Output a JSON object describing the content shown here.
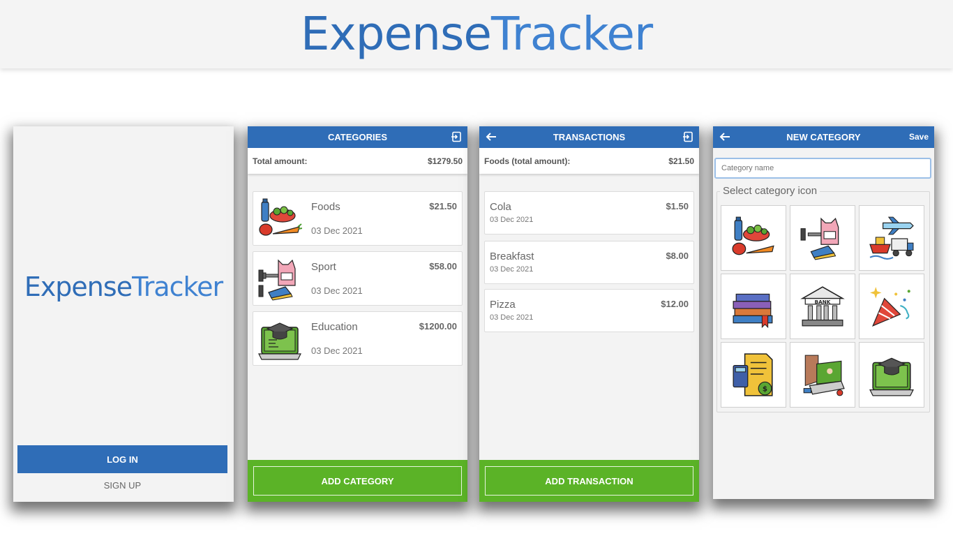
{
  "banner": {
    "logo_part1": "Expense",
    "logo_part2": "Tracker"
  },
  "login_screen": {
    "logo_part1": "Expense",
    "logo_part2": "Tracker",
    "login_label": "LOG IN",
    "signup_label": "SIGN UP"
  },
  "categories_screen": {
    "title": "CATEGORIES",
    "total_label": "Total amount:",
    "total_value": "$1279.50",
    "items": [
      {
        "name": "Foods",
        "amount": "$21.50",
        "date": "03 Dec 2021",
        "icon": "foods-icon"
      },
      {
        "name": "Sport",
        "amount": "$58.00",
        "date": "03 Dec 2021",
        "icon": "sport-icon"
      },
      {
        "name": "Education",
        "amount": "$1200.00",
        "date": "03 Dec 2021",
        "icon": "education-icon"
      }
    ],
    "add_label": "ADD CATEGORY"
  },
  "transactions_screen": {
    "title": "TRANSACTIONS",
    "total_label": "Foods (total amount):",
    "total_value": "$21.50",
    "items": [
      {
        "name": "Cola",
        "amount": "$1.50",
        "date": "03 Dec 2021"
      },
      {
        "name": "Breakfast",
        "amount": "$8.00",
        "date": "03 Dec 2021"
      },
      {
        "name": "Pizza",
        "amount": "$12.00",
        "date": "03 Dec 2021"
      }
    ],
    "add_label": "ADD TRANSACTION"
  },
  "new_category_screen": {
    "title": "NEW CATEGORY",
    "save_label": "Save",
    "name_placeholder": "Category name",
    "icon_legend": "Select category icon",
    "icons": [
      "foods-icon",
      "sport-icon",
      "travel-icon",
      "books-icon",
      "bank-icon",
      "party-icon",
      "bills-icon",
      "computer-icon",
      "education-icon"
    ]
  },
  "colors": {
    "primary": "#2f6db7",
    "accent_green": "#5bb327",
    "background": "#f3f3f3"
  }
}
